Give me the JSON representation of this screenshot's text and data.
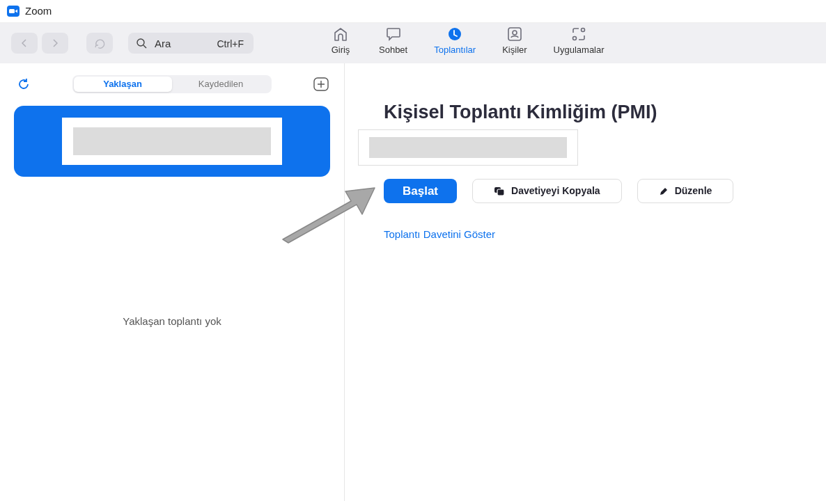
{
  "window": {
    "title": "Zoom"
  },
  "search": {
    "placeholder": "Ara",
    "shortcut": "Ctrl+F"
  },
  "nav": [
    {
      "label": "Giriş",
      "kind": "home",
      "selected": false
    },
    {
      "label": "Sohbet",
      "kind": "chat",
      "selected": false
    },
    {
      "label": "Toplantılar",
      "kind": "clock",
      "selected": true
    },
    {
      "label": "Kişiler",
      "kind": "contact",
      "selected": false
    },
    {
      "label": "Uygulamalar",
      "kind": "apps",
      "selected": false
    }
  ],
  "sidebar": {
    "tabs": [
      {
        "label": "Yaklaşan",
        "selected": true
      },
      {
        "label": "Kaydedilen",
        "selected": false
      }
    ],
    "empty_text": "Yaklaşan toplantı yok"
  },
  "main": {
    "title": "Kişisel Toplantı Kimliğim (PMI)",
    "buttons": [
      {
        "label": "Başlat",
        "kind": "primary"
      },
      {
        "label": "Davetiyeyi Kopyala",
        "kind": "copy"
      },
      {
        "label": "Düzenle",
        "kind": "edit"
      }
    ],
    "link": "Toplantı Davetini Göster"
  }
}
